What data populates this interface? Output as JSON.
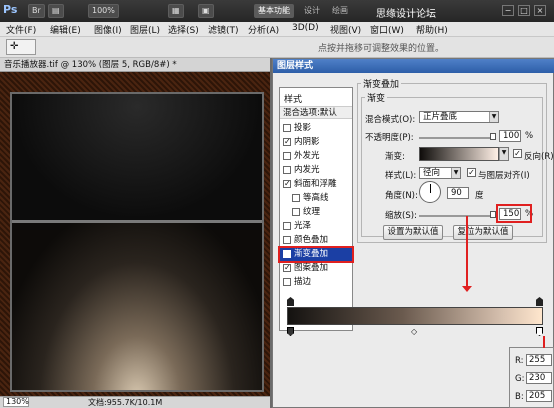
{
  "app": {
    "logo": "Ps",
    "toolbar_icons": [
      "Br",
      "▤",
      "100%",
      "▦",
      "▣"
    ],
    "workspaces": [
      "基本功能",
      "设计",
      "绘画",
      "校正"
    ],
    "active_workspace": "基本功能",
    "brand": "思缘设计论坛",
    "window_controls": [
      "−",
      "□",
      "×"
    ]
  },
  "menubar": {
    "items": [
      "文件(F)",
      "编辑(E)",
      "图像(I)",
      "图层(L)",
      "选择(S)",
      "滤镜(T)",
      "分析(A)",
      "3D(D)",
      "视图(V)",
      "窗口(W)",
      "帮助(H)"
    ]
  },
  "optionsbar": {
    "tool_glyph": "✛",
    "hint": "点按并拖移可调整效果的位置。"
  },
  "document": {
    "tab_title": "音乐播放器.tif @ 130% (图层 5, RGB/8#) *",
    "zoom": "130%",
    "doc_info": "文档:955.7K/10.1M"
  },
  "dialog": {
    "title": "图层样式",
    "list_header": "样式",
    "blend_default": "混合选项:默认",
    "effects": [
      {
        "label": "投影",
        "checked": false,
        "sub": false
      },
      {
        "label": "内阴影",
        "checked": true,
        "sub": false
      },
      {
        "label": "外发光",
        "checked": false,
        "sub": false
      },
      {
        "label": "内发光",
        "checked": false,
        "sub": false
      },
      {
        "label": "斜面和浮雕",
        "checked": true,
        "sub": false
      },
      {
        "label": "等高线",
        "checked": false,
        "sub": true
      },
      {
        "label": "纹理",
        "checked": false,
        "sub": true
      },
      {
        "label": "光泽",
        "checked": false,
        "sub": false
      },
      {
        "label": "颜色叠加",
        "checked": false,
        "sub": false
      },
      {
        "label": "渐变叠加",
        "checked": true,
        "sub": false,
        "selected": true
      },
      {
        "label": "图案叠加",
        "checked": true,
        "sub": false
      },
      {
        "label": "描边",
        "checked": false,
        "sub": false
      }
    ],
    "section_title": "渐变叠加",
    "group_title": "渐变",
    "blend_mode_label": "混合模式(O):",
    "blend_mode_value": "正片叠底",
    "opacity_label": "不透明度(P):",
    "opacity_value": "100",
    "opacity_unit": "%",
    "opacity_level": 1.0,
    "gradient_label": "渐变:",
    "reverse_label": "反向(R)",
    "reverse_checked": true,
    "style_label": "样式(L):",
    "style_value": "径向",
    "align_label": "与图层对齐(I)",
    "align_checked": true,
    "angle_label": "角度(N):",
    "angle_value": "90",
    "angle_unit": "度",
    "scale_label": "缩放(S):",
    "scale_value": "150",
    "scale_unit": "%",
    "scale_level": 1.0,
    "btn_set_default": "设置为默认值",
    "btn_reset_default": "复位为默认值",
    "check_glyph": "✓"
  },
  "rgb": {
    "r_label": "R:",
    "r_value": "255",
    "g_label": "G:",
    "g_value": "230",
    "b_label": "B:",
    "b_value": "205"
  },
  "colors": {
    "highlight": "#e02020",
    "selection": "#1b3fa4",
    "title_bar": "#2d5ea8"
  }
}
